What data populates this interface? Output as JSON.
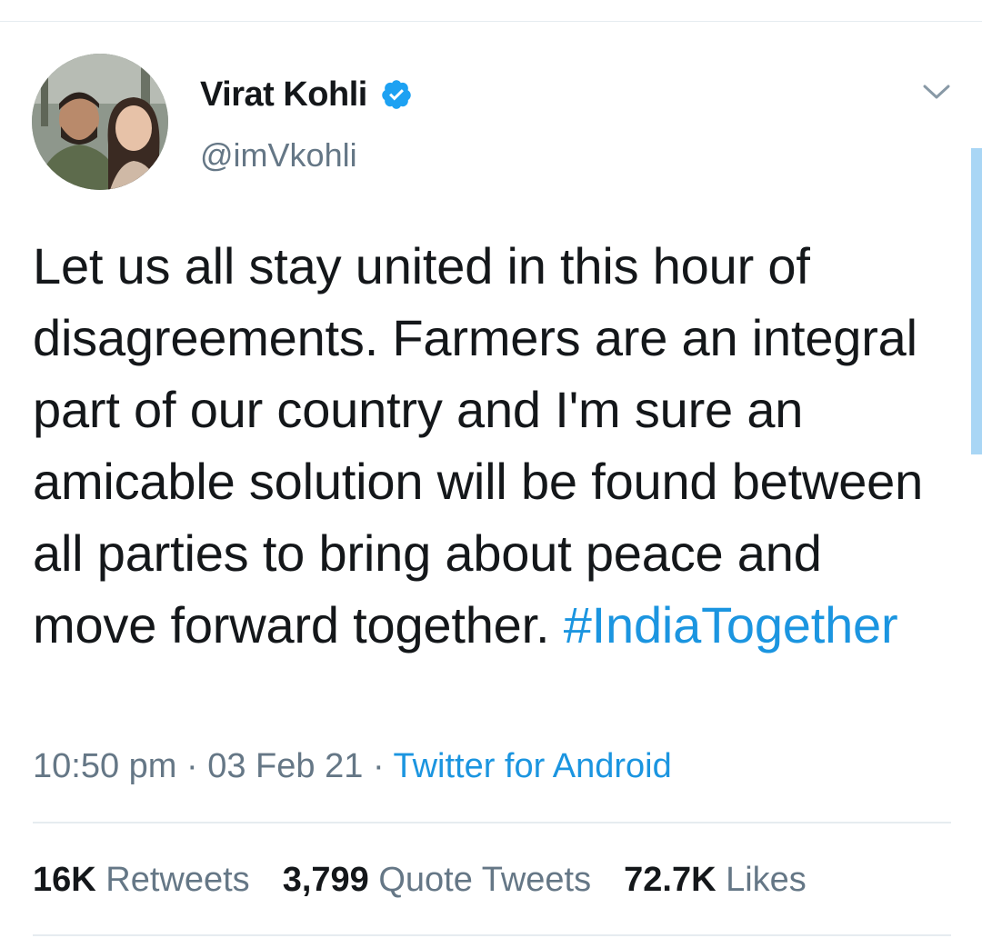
{
  "user": {
    "name": "Virat Kohli",
    "handle": "@imVkohli",
    "verified": true
  },
  "tweet": {
    "text": "Let us all stay united in this hour of disagreements. Farmers are an integral part of our country and I'm sure an amicable solution will be found between all parties to bring about peace and move forward together.",
    "hashtag": "#IndiaTogether"
  },
  "meta": {
    "time": "10:50 pm",
    "separator": "·",
    "date": "03 Feb 21",
    "source": "Twitter for Android"
  },
  "stats": {
    "retweets_count": "16K",
    "retweets_label": "Retweets",
    "quotes_count": "3,799",
    "quotes_label": "Quote Tweets",
    "likes_count": "72.7K",
    "likes_label": "Likes"
  },
  "icons": {
    "verified": "verified-badge-icon",
    "menu": "chevron-down-icon"
  },
  "colors": {
    "link": "#1b95e0",
    "secondary_text": "#657786",
    "primary_text": "#14171a",
    "divider": "#e6ecf0",
    "scrollbar": "#a9d6f5"
  }
}
